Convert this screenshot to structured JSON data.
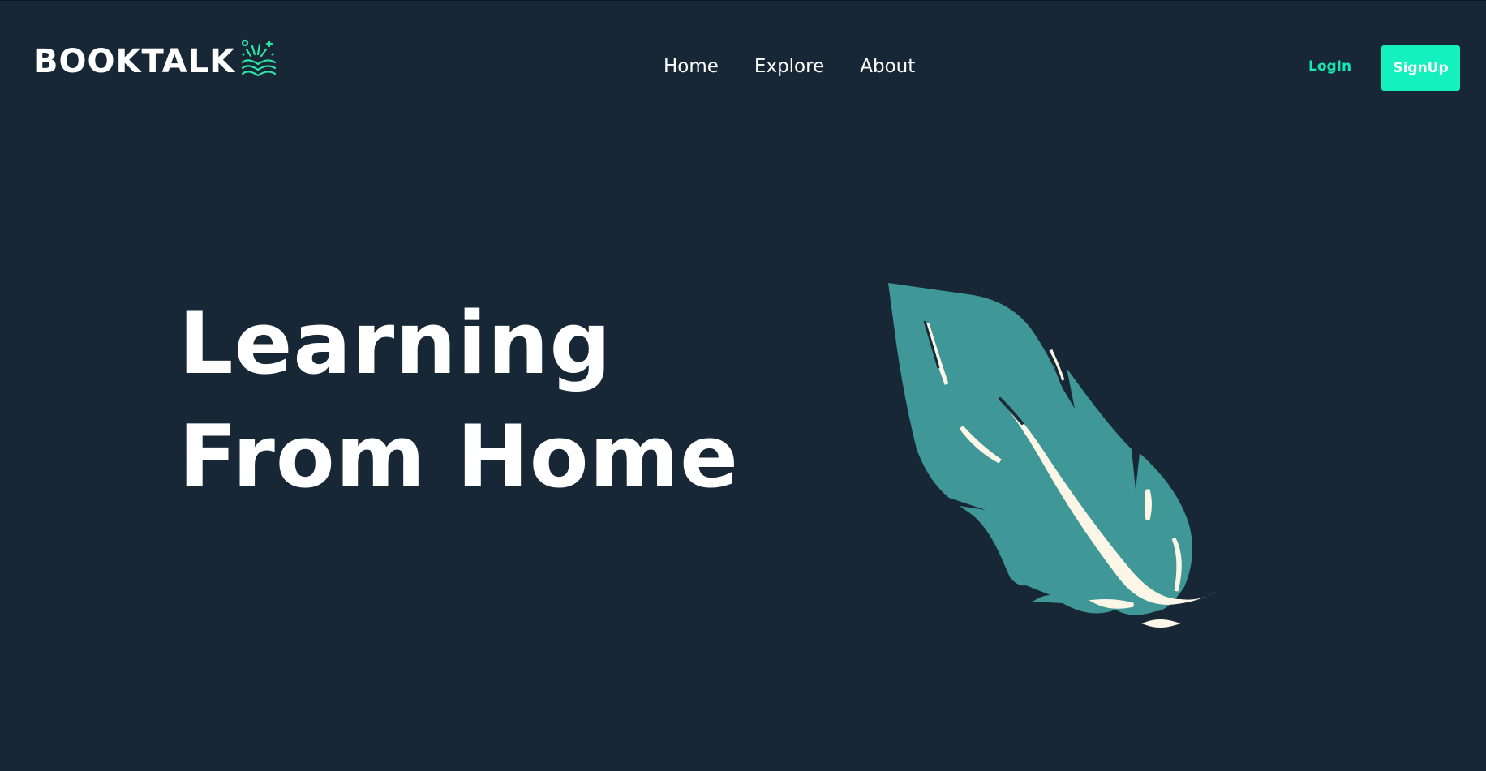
{
  "brand": {
    "name": "BOOKTALK",
    "icon": "open-book-sparkle-icon"
  },
  "nav": {
    "items": [
      {
        "label": "Home"
      },
      {
        "label": "Explore"
      },
      {
        "label": "About"
      }
    ]
  },
  "auth": {
    "login_label": "LogIn",
    "signup_label": "SignUp"
  },
  "hero": {
    "line1": "Learning",
    "line2": "From Home",
    "illustration": "feather-icon"
  },
  "colors": {
    "background": "#172736",
    "accent": "#14f0be",
    "feather": "#3f9797",
    "feather_highlight": "#fbf6e6",
    "text": "#ffffff"
  }
}
